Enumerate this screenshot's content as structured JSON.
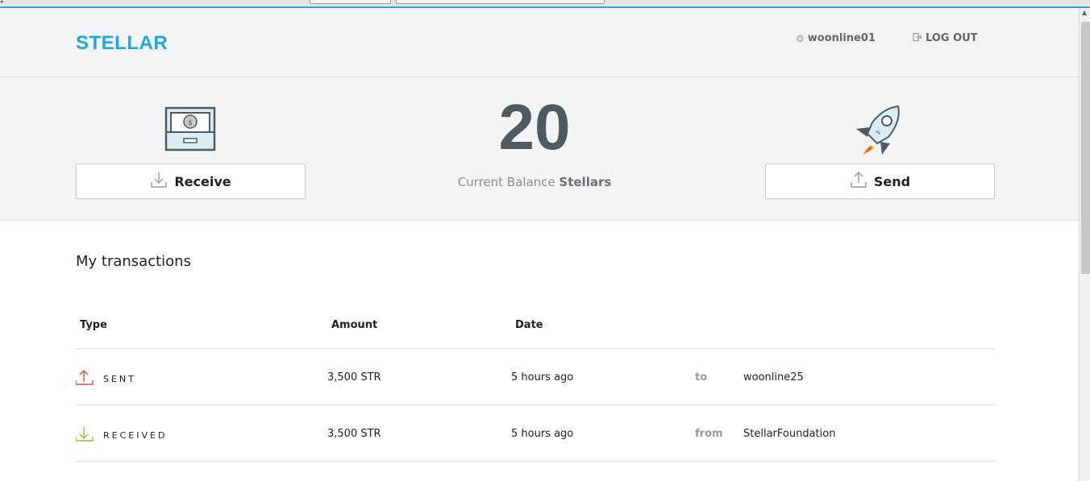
{
  "app": {
    "logo": "STELLAR"
  },
  "header": {
    "username": "woonline01",
    "logout_label": "LOG OUT"
  },
  "balance": {
    "value": "20",
    "caption_prefix": "Current Balance",
    "caption_unit": "Stellars"
  },
  "actions": {
    "receive_label": "Receive",
    "send_label": "Send"
  },
  "transactions": {
    "title": "My transactions",
    "columns": [
      "Type",
      "Amount",
      "Date"
    ],
    "rows": [
      {
        "type": "SENT",
        "amount": "3,500 STR",
        "date": "5 hours ago",
        "preposition": "to",
        "party": "woonline25",
        "color": "#d9534f"
      },
      {
        "type": "RECEIVED",
        "amount": "3,500 STR",
        "date": "5 hours ago",
        "preposition": "from",
        "party": "StellarFoundation",
        "color": "#8cc63f"
      }
    ]
  },
  "colors": {
    "brand": "#1ea8dc",
    "balance_text": "#4f5b63",
    "sent": "#d9534f",
    "received": "#8cc63f"
  }
}
